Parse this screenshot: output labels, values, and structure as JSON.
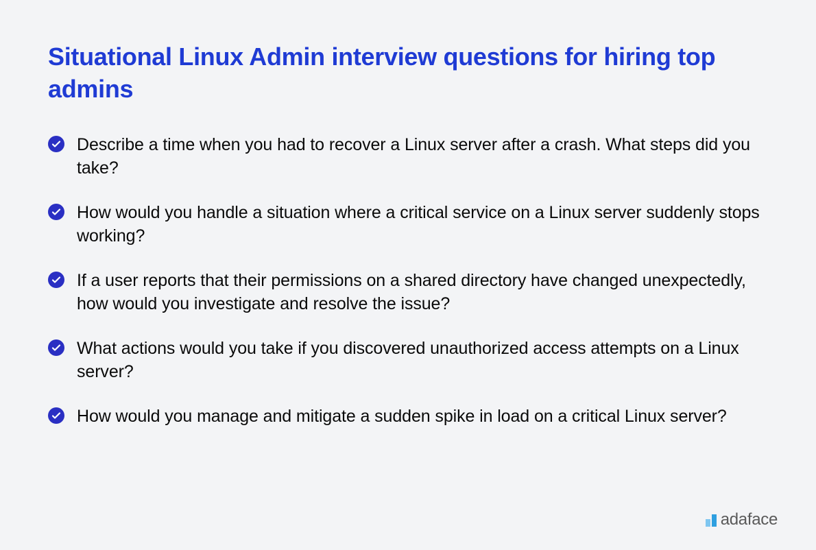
{
  "title": "Situational Linux Admin interview questions for hiring top admins",
  "questions": [
    "Describe a time when you had to recover a Linux server after a crash. What steps did you take?",
    "How would you handle a situation where a critical service on a Linux server suddenly stops working?",
    "If a user reports that their permissions on a shared directory have changed unexpectedly, how would you investigate and resolve the issue?",
    "What actions would you take if you discovered unauthorized access attempts on a Linux server?",
    "How would you manage and mitigate a sudden spike in load on a critical Linux server?"
  ],
  "logo": {
    "text": "adaface"
  }
}
